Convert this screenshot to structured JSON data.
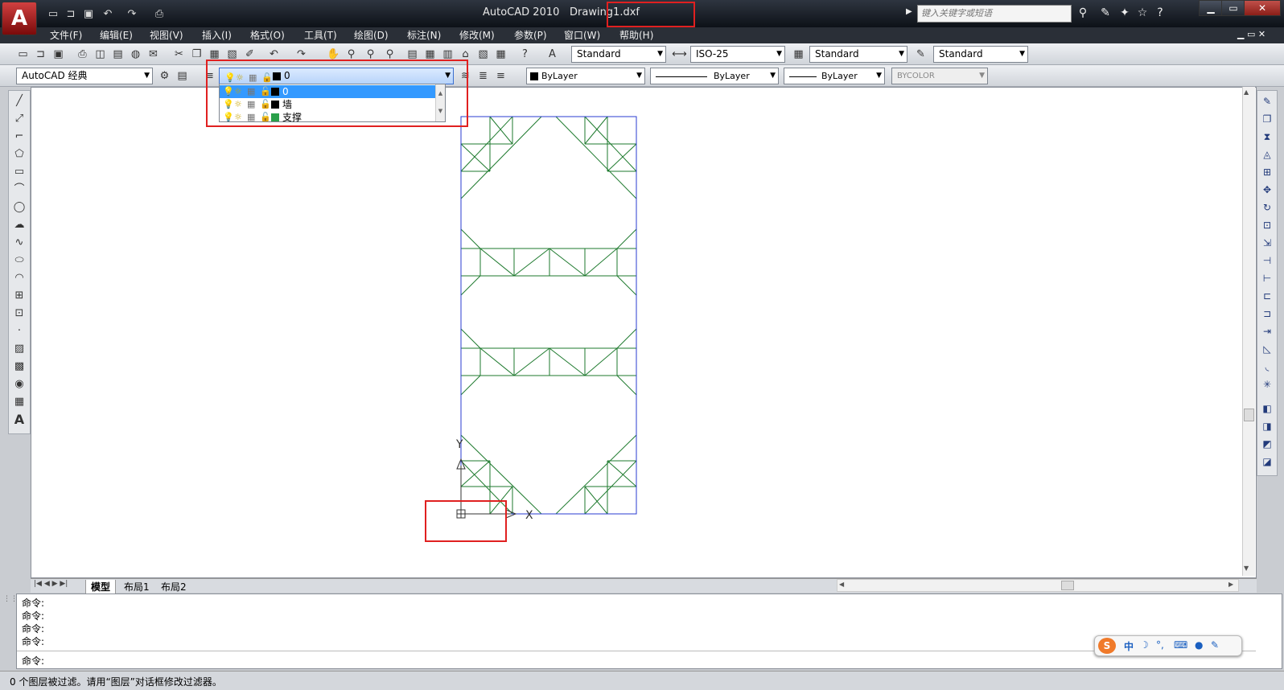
{
  "app": {
    "logo_letter": "A",
    "title": "AutoCAD 2010",
    "file": "Drawing1.dxf"
  },
  "search": {
    "placeholder": "键入关键字或短语"
  },
  "menu": [
    "文件(F)",
    "编辑(E)",
    "视图(V)",
    "插入(I)",
    "格式(O)",
    "工具(T)",
    "绘图(D)",
    "标注(N)",
    "修改(M)",
    "参数(P)",
    "窗口(W)",
    "帮助(H)"
  ],
  "styles": {
    "text_style": "Standard",
    "dim_style": "ISO-25",
    "table_style": "Standard",
    "multileader_style": "Standard"
  },
  "workspace": "AutoCAD 经典",
  "layer": {
    "current": "0",
    "items": [
      {
        "name": "0",
        "color": "#000000",
        "selected": true
      },
      {
        "name": "墙",
        "color": "#000000",
        "selected": false
      },
      {
        "name": "支撑",
        "color": "#2aa04a",
        "selected": false
      }
    ]
  },
  "properties": {
    "color": "ByLayer",
    "linetype": "ByLayer",
    "lineweight": "ByLayer",
    "plotstyle": "BYCOLOR"
  },
  "tabs": [
    "模型",
    "布局1",
    "布局2"
  ],
  "commands": [
    "命令:",
    "命令:",
    "命令:",
    "命令:"
  ],
  "prompt": "命令:",
  "status": "0 个图层被过滤。请用“图层”对话框修改过滤器。",
  "ucs": {
    "x": "X",
    "y": "Y"
  },
  "ime": {
    "lang": "中"
  },
  "colors": {
    "frame": "#2a3bd0",
    "brace": "#1e7a2e",
    "highlight": "#e02020"
  }
}
